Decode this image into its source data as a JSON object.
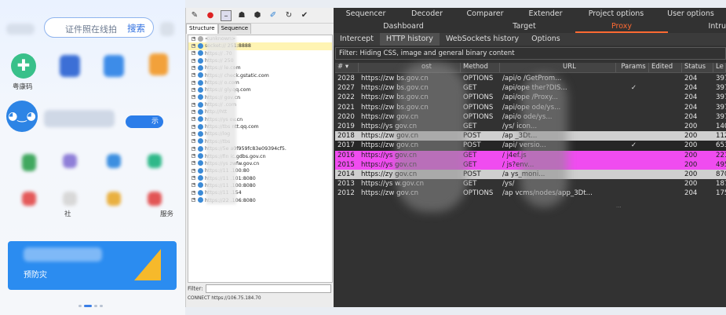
{
  "phone": {
    "search_placeholder": "证件照在线拍",
    "search_button": "搜索",
    "health_code_label": "粤康码",
    "mascot_icon": "mascot-icon",
    "blue_button_text": "示",
    "label_she": "社",
    "label_service": "服务",
    "banner_text": "预防灾"
  },
  "middle": {
    "toolbar_icons": [
      "brush-icon",
      "record-icon",
      "stop-icon",
      "turtle-icon",
      "hexagon-icon",
      "pen-icon",
      "refresh-icon",
      "check-icon"
    ],
    "tabs": [
      "Structure",
      "Sequence"
    ],
    "tree": [
      {
        "text": "<unknown>",
        "gray": true
      },
      {
        "text": "socket://                 251:8888",
        "selected": true
      },
      {
        "text": "https://                   .70"
      },
      {
        "text": "https://                   250"
      },
      {
        "text": "https://                 le.com"
      },
      {
        "text": "https://             check.gstatic.com"
      },
      {
        "text": "https://                 o.com"
      },
      {
        "text": "https://              gly.qq.com"
      },
      {
        "text": "https://                 gov.cn"
      },
      {
        "text": "https://                 .com"
      },
      {
        "text": "http://htt"
      },
      {
        "text": "https://ys                 ov.cn"
      },
      {
        "text": "https://tbs              ntt.qq.com"
      },
      {
        "text": "https://log"
      },
      {
        "text": "https://tbs"
      },
      {
        "text": "https://5e          a0f959fc83e09394cf5."
      },
      {
        "text": "https://fin           ic.gdbs.gov.cn"
      },
      {
        "text": "https://ys            zwfw.gov.cn"
      },
      {
        "text": "https://11            .100:80"
      },
      {
        "text": "https://11            .101:8080"
      },
      {
        "text": "https://11            .100:8080"
      },
      {
        "text": "https://11            .154"
      },
      {
        "text": "https://22            .106:8080"
      }
    ],
    "filter_label": "Filter:",
    "status_text": "CONNECT https://106.75.184.70"
  },
  "burp": {
    "tabs_row1": [
      "Sequencer",
      "Decoder",
      "Comparer",
      "Extender",
      "Project options",
      "User options"
    ],
    "tabs_row2": [
      "Dashboard",
      "Target",
      "Proxy",
      "Intru"
    ],
    "tabs_row3": [
      "Intercept",
      "HTTP history",
      "WebSockets history",
      "Options"
    ],
    "filter_text": "Filter: Hiding CSS, image and general binary content",
    "columns": [
      "# ▾",
      "ost",
      "Method",
      "URL",
      "Params",
      "Edited",
      "Status",
      "Le"
    ],
    "rows": [
      {
        "num": "2028",
        "host": "https://zw     bs.gov.cn",
        "method": "OPTIONS",
        "url": "/api/o                /GetProm...",
        "params": "",
        "status": "204",
        "len": "397",
        "style": ""
      },
      {
        "num": "2027",
        "host": "https://zw     bs.gov.cn",
        "method": "GET",
        "url": "/api/ope              ther?DIS...",
        "params": "✓",
        "status": "204",
        "len": "397",
        "style": ""
      },
      {
        "num": "2022",
        "host": "https://zw     bs.gov.cn",
        "method": "OPTIONS",
        "url": "/api/ope              /Proxy...",
        "params": "",
        "status": "204",
        "len": "397",
        "style": ""
      },
      {
        "num": "2021",
        "host": "https://zw     bs.gov.cn",
        "method": "OPTIONS",
        "url": "/api/ope              ode/ys...",
        "params": "",
        "status": "204",
        "len": "397",
        "style": ""
      },
      {
        "num": "2020",
        "host": "https://zw     gov.cn",
        "method": "OPTIONS",
        "url": "/api/o               ode/ys...",
        "params": "",
        "status": "204",
        "len": "397",
        "style": ""
      },
      {
        "num": "2019",
        "host": "https://ys     gov.cn",
        "method": "GET",
        "url": "/ys/             icon...",
        "params": "",
        "status": "200",
        "len": "140",
        "style": ""
      },
      {
        "num": "2018",
        "host": "https://zw     gov.cn",
        "method": "POST",
        "url": "/ap               _3Dt...",
        "params": "",
        "status": "200",
        "len": "112",
        "style": "hl-gray"
      },
      {
        "num": "2017",
        "host": "https://zw     gov.cn",
        "method": "POST",
        "url": "/api/           versio...",
        "params": "✓",
        "status": "200",
        "len": "653",
        "style": "hl-dark"
      },
      {
        "num": "2016",
        "host": "https://ys     gov.cn",
        "method": "GET",
        "url": "/             j4ef.js",
        "params": "",
        "status": "200",
        "len": "221",
        "style": "hl-pink"
      },
      {
        "num": "2015",
        "host": "https://ys     gov.cn",
        "method": "GET",
        "url": "/               js?env...",
        "params": "",
        "status": "200",
        "len": "495",
        "style": "hl-pink"
      },
      {
        "num": "2014",
        "host": "https://zy     gov.cn",
        "method": "POST",
        "url": "/a             ys_moni...",
        "params": "",
        "status": "200",
        "len": "870",
        "style": "hl-gray"
      },
      {
        "num": "2013",
        "host": "https://ys     w.gov.cn",
        "method": "GET",
        "url": "/ys/              ",
        "params": "",
        "status": "200",
        "len": "187",
        "style": ""
      },
      {
        "num": "2012",
        "host": "https://zw     gov.cn",
        "method": "OPTIONS",
        "url": "/ap          vcms/nodes/app_3Dt...",
        "params": "",
        "status": "204",
        "len": "175",
        "style": ""
      }
    ],
    "more_indicator": "..."
  }
}
